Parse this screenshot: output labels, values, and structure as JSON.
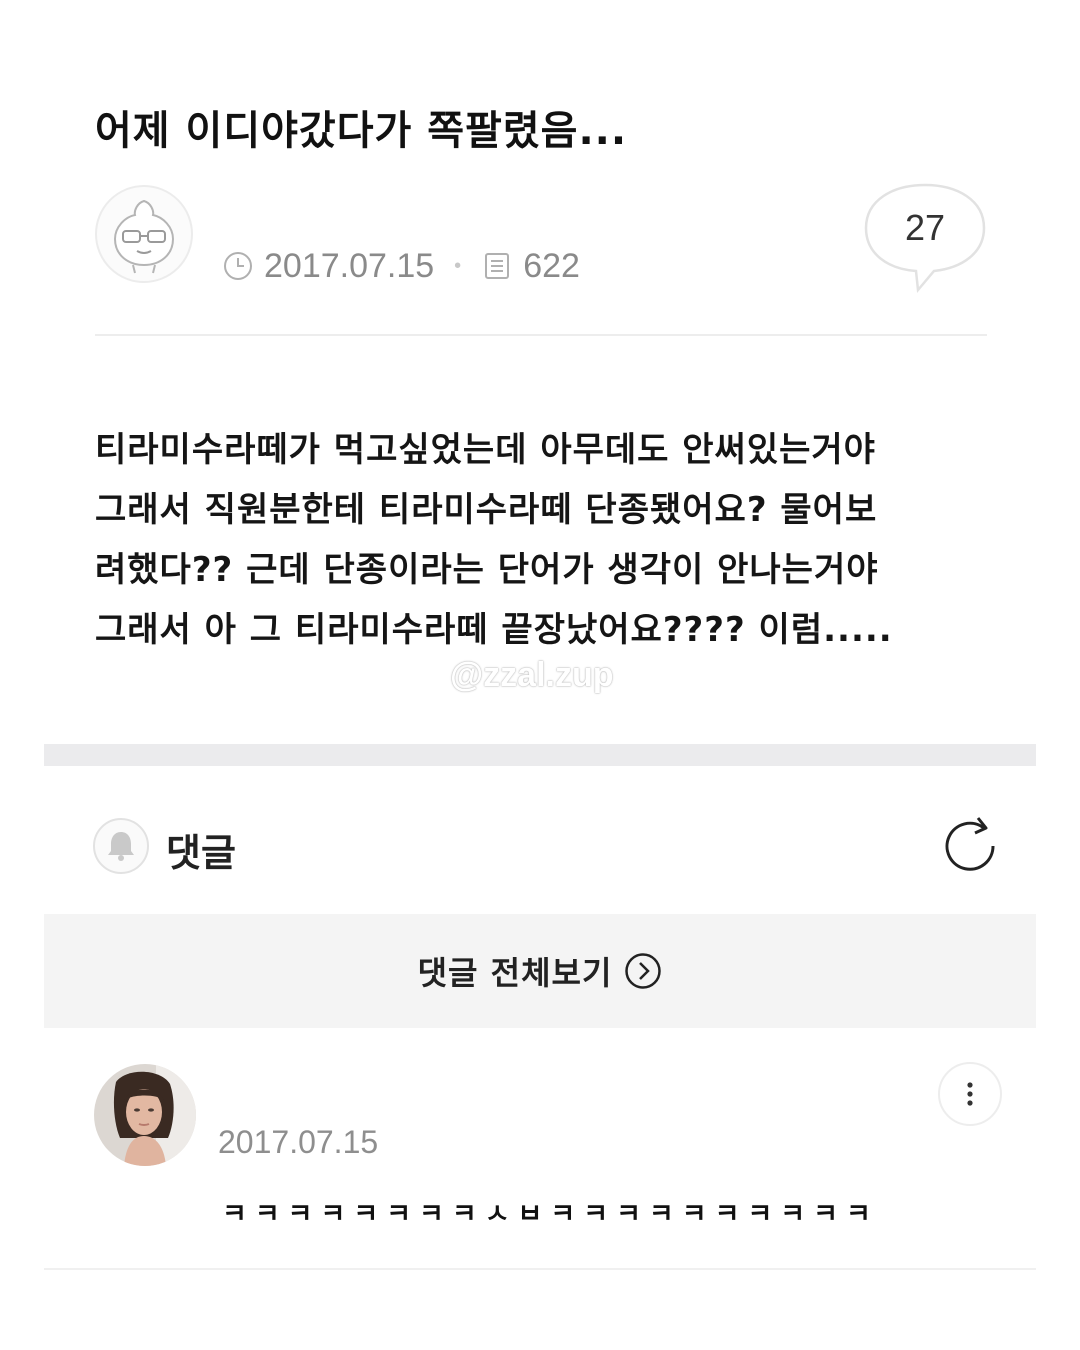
{
  "post": {
    "title": "어제 이디야갔다가 쪽팔렸음...",
    "date": "2017.07.15",
    "views": "622",
    "comment_count": "27",
    "body_lines": [
      "티라미수라떼가 먹고싶었는데 아무데도 안써있는거야",
      "그래서 직원분한테 티라미수라떼 단종됐어요? 물어보",
      "려했다?? 근데 단종이라는 단어가 생각이 안나는거야",
      "그래서 아 그 티라미수라떼 끝장났어요???? 이럼....."
    ]
  },
  "watermark": "@zzal.zup",
  "comments": {
    "header_label": "댓글",
    "view_all_label": "댓글 전체보기",
    "items": [
      {
        "date": "2017.07.15",
        "text": "ㅋㅋㅋㅋㅋㅋㅋㅋㅅㅂㅋㅋㅋㅋㅋㅋㅋㅋㅋㅋ"
      }
    ]
  },
  "icons": {
    "clock": "clock-icon",
    "views": "document-icon",
    "comment": "speech-bubble-icon",
    "bell": "bell-icon",
    "refresh": "refresh-icon",
    "arrow": "chevron-right-circle-icon",
    "more": "more-vertical-icon"
  },
  "colors": {
    "meta_gray": "#8a8a8a",
    "band": "#ebebed",
    "view_all_bg": "#f4f4f4"
  }
}
